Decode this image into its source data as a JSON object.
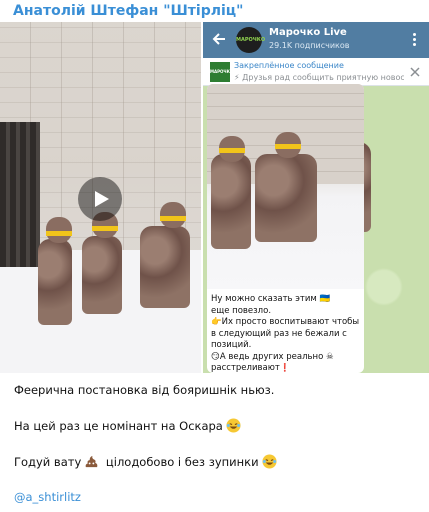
{
  "post": {
    "author": "Анатолій Штефан \"Штірліц\"",
    "lines": [
      "Феерична постановка від бояришнік ньюз.",
      "На цей раз це номінант на Оскара",
      "Годуй вату",
      "цілодобово і без зупинки"
    ],
    "hashtag": "@a_shtirlitz"
  },
  "screenshot": {
    "channel_name": "Марочко Live",
    "subscribers": "29.1K подписчиков",
    "avatar_text": "МАРОЧКО LIVE",
    "pinned_title": "Закреплённое сообщение",
    "pinned_text": "⚡ Друзья рад сообщить приятную новост...",
    "pinned_thumb_text": "МАРОЧКО",
    "message_lines": [
      "Ну можно сказать этим 🇺🇦",
      "еще повезло.",
      "👉Их просто воспитывают чтобы",
      "в следующий раз не бежали с",
      "позиций.",
      "😏А ведь других реально ☠",
      "расстреливают❗"
    ]
  },
  "colors": {
    "author": "#3a8fd6",
    "header": "#517da2",
    "chat_bg": "#c9dfae",
    "hashtag": "#3a8fd6"
  },
  "icons": [
    "play-icon",
    "back-arrow-icon",
    "more-vertical-icon",
    "pin-close-icon",
    "laughing-emoji-icon",
    "poop-emoji-icon"
  ]
}
